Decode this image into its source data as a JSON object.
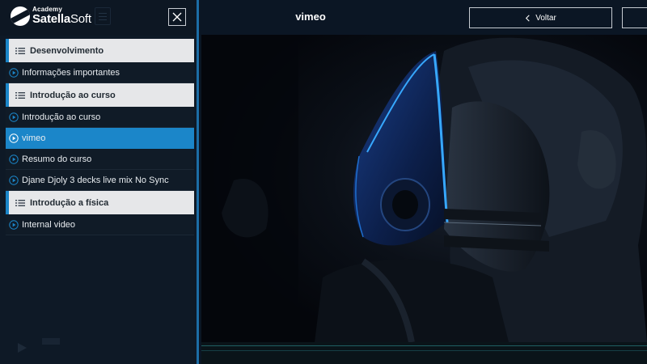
{
  "brand": {
    "academy": "Academy",
    "name_bold": "Satella",
    "name_light": "Soft"
  },
  "sidebar": {
    "sections": [
      {
        "label": "Desenvolvimento",
        "items": [
          {
            "label": "Informações importantes",
            "active": false
          }
        ]
      },
      {
        "label": "Introdução ao curso",
        "items": [
          {
            "label": "Introdução ao curso",
            "active": false
          },
          {
            "label": "vimeo",
            "active": true
          },
          {
            "label": "Resumo do curso",
            "active": false
          },
          {
            "label": "Djane Djoly 3 decks live mix No Sync",
            "active": false
          }
        ]
      },
      {
        "label": "Introdução a física",
        "items": [
          {
            "label": "Internal video",
            "active": false
          }
        ]
      }
    ]
  },
  "header": {
    "title": "vimeo",
    "back_label": "Voltar"
  },
  "colors": {
    "accent": "#1b86c9",
    "sidebar_bg": "#0e1926",
    "section_bg": "#e6e7e9"
  },
  "icons": {
    "close": "close-icon",
    "list": "list-icon",
    "play": "play-circle-icon",
    "back": "chevron-left-icon"
  }
}
